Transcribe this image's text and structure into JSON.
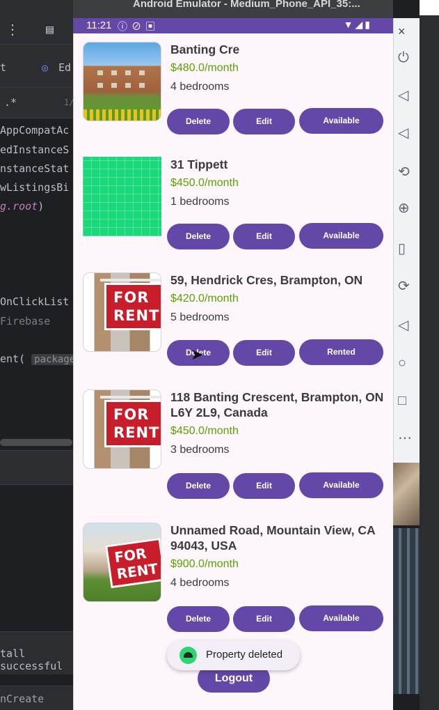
{
  "emulator": {
    "window_title": "Android Emulator - Medium_Phone_API_35:...",
    "status_time": "11:21"
  },
  "ide": {
    "tab_fragment": "Ed",
    "code_lines": [
      "AppCompatAc",
      "edInstanceS",
      "nstanceStat",
      "wListingsBi"
    ],
    "root_line_prefix": "g.",
    "root_line_word": "root",
    "root_line_suffix": ")",
    "onclick_line": "OnClickList",
    "firebase_line": "Firebase",
    "intent_line": "ent(",
    "intent_hint": "package",
    "build_message": "tall successful",
    "bottom_line": "nCreate",
    "close_glyph": "×"
  },
  "listings": [
    {
      "title": "Banting Cre",
      "price": "$480.0/month",
      "bedrooms": "4 bedrooms",
      "delete_label": "Delete",
      "edit_label": "Edit",
      "status_label": "Available",
      "image": "apartment-building-photo"
    },
    {
      "title": "31 Tippett",
      "price": "$450.0/month",
      "bedrooms": "1 bedrooms",
      "delete_label": "Delete",
      "edit_label": "Edit",
      "status_label": "Available",
      "image": "green-grid-placeholder"
    },
    {
      "title": "59, Hendrick Cres, Brampton, ON",
      "price": "$420.0/month",
      "bedrooms": "5 bedrooms",
      "delete_label": "Delete",
      "edit_label": "Edit",
      "status_label": "Rented",
      "image": "for-rent-sign-photo"
    },
    {
      "title": "118 Banting Crescent, Brampton, ON L6Y 2L9, Canada",
      "price": "$450.0/month",
      "bedrooms": "3 bedrooms",
      "delete_label": "Delete",
      "edit_label": "Edit",
      "status_label": "Available",
      "image": "for-rent-sign-photo"
    },
    {
      "title": "Unnamed Road, Mountain View, CA 94043, USA",
      "price": "$900.0/month",
      "bedrooms": "4 bedrooms",
      "delete_label": "Delete",
      "edit_label": "Edit",
      "status_label": "Available",
      "image": "house-for-rent-photo"
    }
  ],
  "sign_text": {
    "line1": "FOR",
    "line2": "RENT"
  },
  "toast": {
    "message": "Property deleted",
    "icon": "android-icon"
  },
  "logout_label": "Logout",
  "colors": {
    "primary": "#6448a8",
    "price": "#5aa300",
    "background": "#fdf6fb"
  }
}
